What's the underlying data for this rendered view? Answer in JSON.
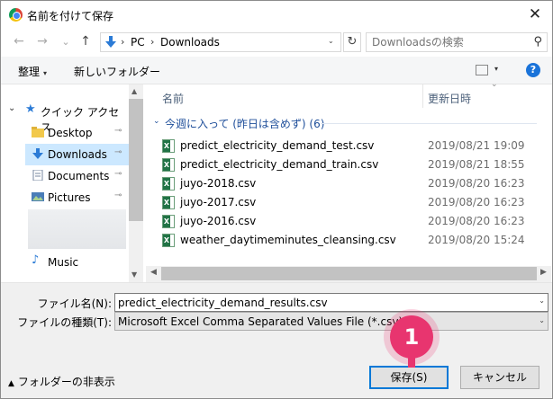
{
  "window": {
    "title": "名前を付けて保存",
    "close_glyph": "✕"
  },
  "nav": {
    "back_glyph": "←",
    "forward_glyph": "→",
    "recent_glyph": "⌄",
    "up_glyph": "↑",
    "breadcrumb": [
      "PC",
      "Downloads"
    ],
    "refresh_glyph": "↻",
    "search_placeholder": "Downloadsの検索",
    "search_glyph": "⚲"
  },
  "toolbar": {
    "organize_label": "整理",
    "new_folder_label": "新しいフォルダー",
    "help_glyph": "?"
  },
  "navpane": {
    "quick_access_label": "クイック アクセス",
    "items": [
      {
        "label": "Desktop",
        "icon": "folder-icon",
        "pinned": true
      },
      {
        "label": "Downloads",
        "icon": "downloads-icon",
        "pinned": true
      },
      {
        "label": "Documents",
        "icon": "documents-icon",
        "pinned": true
      },
      {
        "label": "Pictures",
        "icon": "pictures-icon",
        "pinned": true
      },
      {
        "label": "Music",
        "icon": "music-icon",
        "pinned": false
      }
    ],
    "pin_glyph": "📌"
  },
  "filelist": {
    "col_name": "名前",
    "col_date": "更新日時",
    "group_label": "今週に入って (昨日は含めず) (6)",
    "files": [
      {
        "name": "predict_electricity_demand_test.csv",
        "date": "2019/08/21 19:09"
      },
      {
        "name": "predict_electricity_demand_train.csv",
        "date": "2019/08/21 18:55"
      },
      {
        "name": "juyo-2018.csv",
        "date": "2019/08/20 16:23"
      },
      {
        "name": "juyo-2017.csv",
        "date": "2019/08/20 16:23"
      },
      {
        "name": "juyo-2016.csv",
        "date": "2019/08/20 16:23"
      },
      {
        "name": "weather_daytimeminutes_cleansing.csv",
        "date": "2019/08/20 15:24"
      }
    ]
  },
  "form": {
    "filename_label": "ファイル名(N):",
    "filename_value": "predict_electricity_demand_results.csv",
    "filetype_label": "ファイルの種類(T):",
    "filetype_value": "Microsoft Excel Comma Separated Values File (*.csv)"
  },
  "footer": {
    "hide_folders_label": "フォルダーの非表示",
    "save_label": "保存(S)",
    "cancel_label": "キャンセル"
  },
  "callout": {
    "number": "1"
  },
  "colors": {
    "accent": "#0078d7",
    "selection": "#cce8ff",
    "callout": "#e8356f",
    "excel_green": "#217346"
  }
}
